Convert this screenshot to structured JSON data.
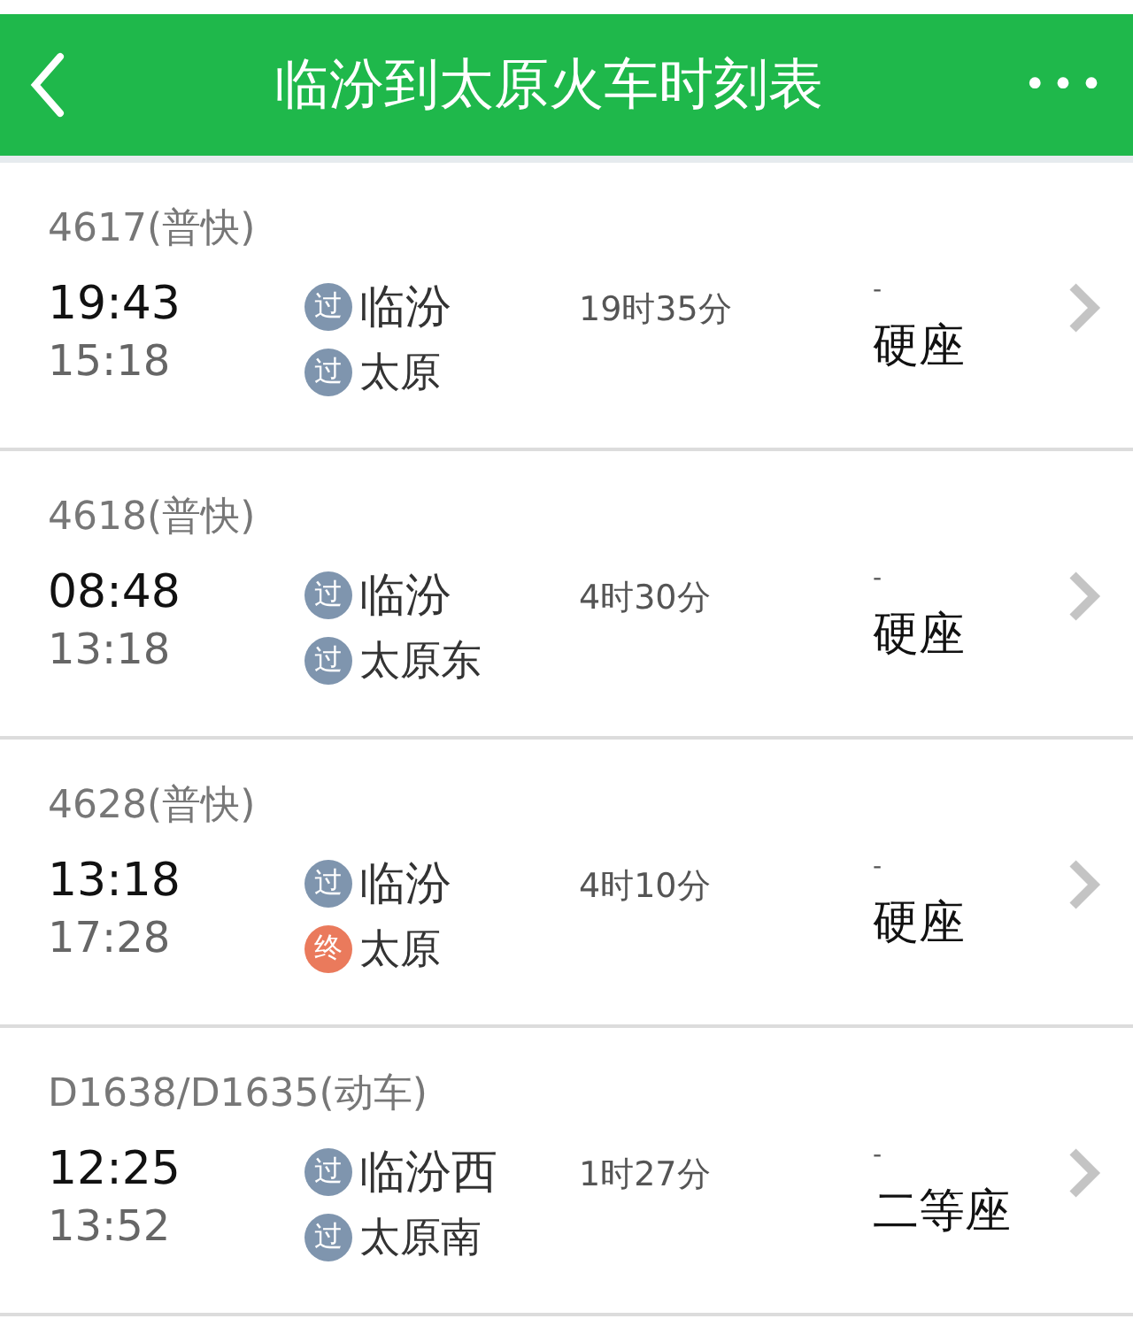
{
  "header": {
    "title": "临汾到太原火车时刻表",
    "more": "•••"
  },
  "trains": [
    {
      "number": "4617(普快)",
      "depart": "19:43",
      "arrive": "15:18",
      "from": {
        "badge": "过",
        "kind": "pass",
        "name": "临汾"
      },
      "to": {
        "badge": "过",
        "kind": "pass",
        "name": "太原"
      },
      "duration": "19时35分",
      "price": "-",
      "seat": "硬座"
    },
    {
      "number": "4618(普快)",
      "depart": "08:48",
      "arrive": "13:18",
      "from": {
        "badge": "过",
        "kind": "pass",
        "name": "临汾"
      },
      "to": {
        "badge": "过",
        "kind": "pass",
        "name": "太原东"
      },
      "duration": "4时30分",
      "price": "-",
      "seat": "硬座"
    },
    {
      "number": "4628(普快)",
      "depart": "13:18",
      "arrive": "17:28",
      "from": {
        "badge": "过",
        "kind": "pass",
        "name": "临汾"
      },
      "to": {
        "badge": "终",
        "kind": "terminal",
        "name": "太原"
      },
      "duration": "4时10分",
      "price": "-",
      "seat": "硬座"
    },
    {
      "number": "D1638/D1635(动车)",
      "depart": "12:25",
      "arrive": "13:52",
      "from": {
        "badge": "过",
        "kind": "pass",
        "name": "临汾西"
      },
      "to": {
        "badge": "过",
        "kind": "pass",
        "name": "太原南"
      },
      "duration": "1时27分",
      "price": "-",
      "seat": "二等座"
    }
  ]
}
